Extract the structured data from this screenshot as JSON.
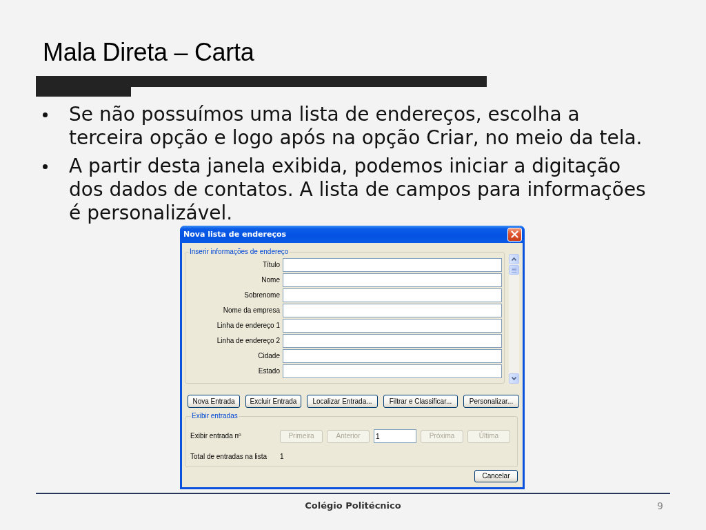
{
  "slide": {
    "title": "Mala Direta – Carta",
    "bullets": [
      "Se não possuímos uma lista de endereços, escolha a terceira opção e logo após na opção Criar, no meio da tela.",
      "A partir desta janela exibida, podemos iniciar a digitação dos dados de contatos. A lista de campos para informações é personalizável."
    ]
  },
  "dialog": {
    "title": "Nova lista de endereços",
    "address_group": {
      "label": "Inserir informações de endereço",
      "fields": [
        {
          "label": "Título"
        },
        {
          "label": "Nome"
        },
        {
          "label": "Sobrenome"
        },
        {
          "label": "Nome da empresa"
        },
        {
          "label": "Linha de endereço 1"
        },
        {
          "label": "Linha de endereço 2"
        },
        {
          "label": "Cidade"
        },
        {
          "label": "Estado"
        }
      ]
    },
    "buttons": [
      {
        "label": "Nova Entrada",
        "disabled": false
      },
      {
        "label": "Excluir Entrada",
        "disabled": false
      },
      {
        "label": "Localizar Entrada...",
        "disabled": false
      },
      {
        "label": "Filtrar e Classificar...",
        "disabled": false
      },
      {
        "label": "Personalizar...",
        "disabled": false
      }
    ],
    "entries_group": {
      "label": "Exibir entradas",
      "entry_label": "Exibir entrada nº",
      "navigation": [
        {
          "kind": "button",
          "label": "Primeira",
          "disabled": true
        },
        {
          "kind": "button",
          "label": "Anterior",
          "disabled": true
        },
        {
          "kind": "field",
          "value": "1",
          "disabled": false
        },
        {
          "kind": "button",
          "label": "Próxima",
          "disabled": true
        },
        {
          "kind": "button",
          "label": "Última",
          "disabled": true
        }
      ],
      "total_label": "Total de entradas na lista",
      "total_value": "1"
    },
    "cancel_button": "Cancelar"
  },
  "footer": {
    "text": "Colégio Politécnico",
    "page": "9"
  }
}
